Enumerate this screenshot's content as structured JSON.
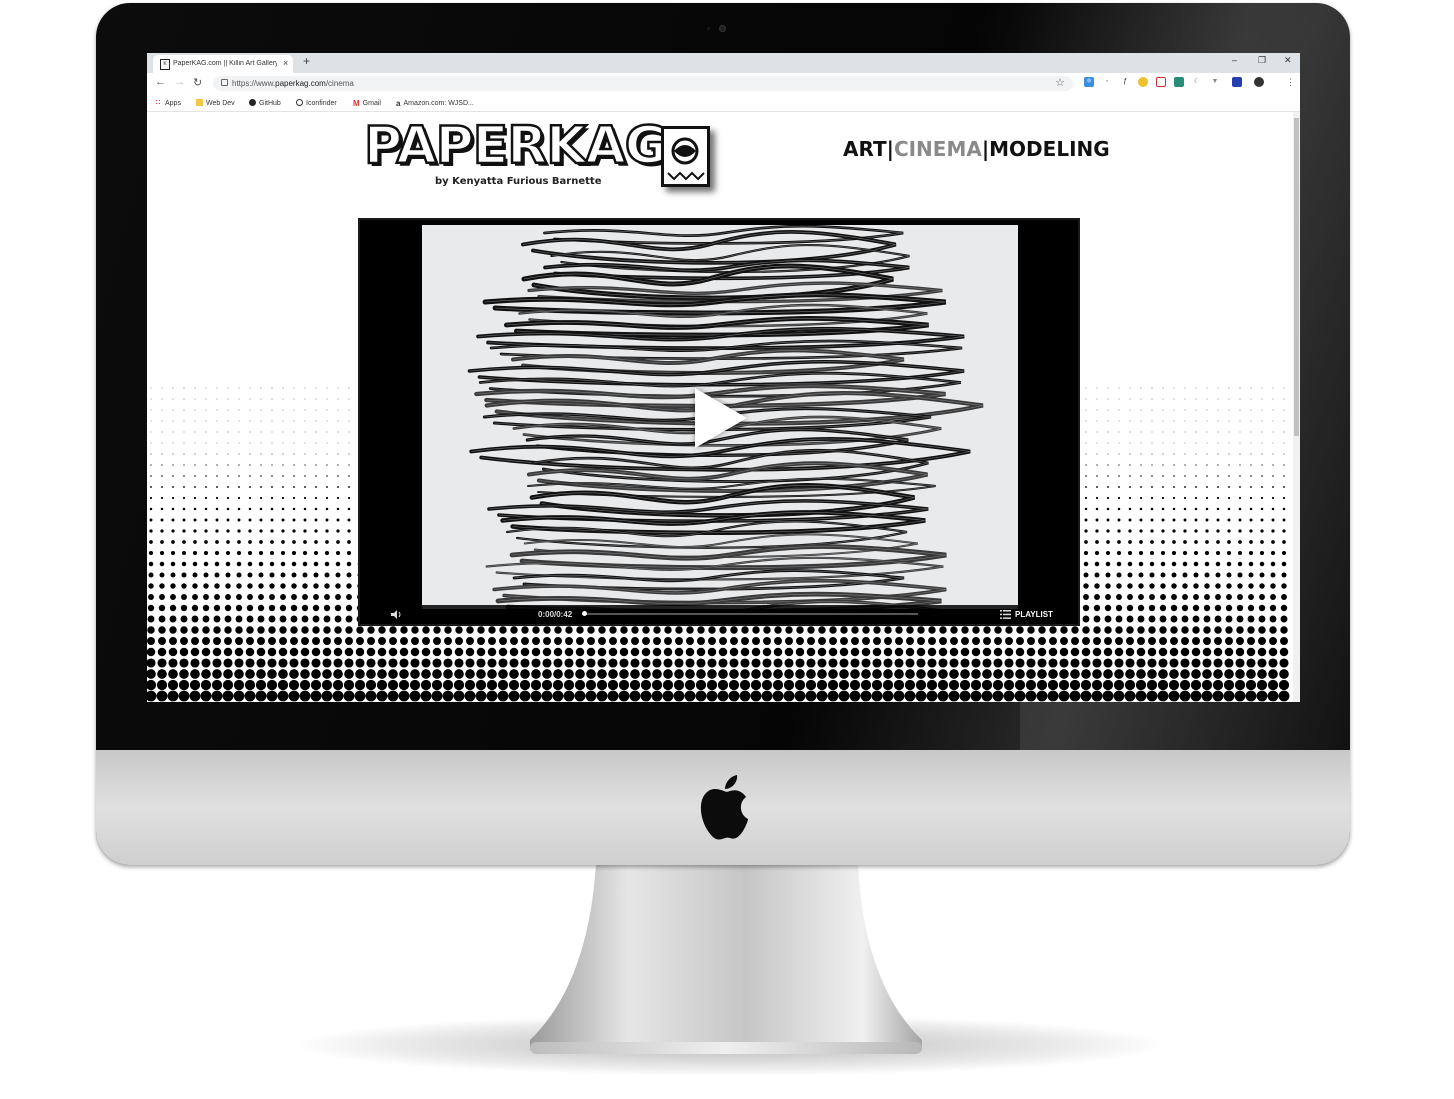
{
  "browser": {
    "tab_title": "PaperKAG.com || Killin Art Gallery",
    "tab_close": "×",
    "new_tab": "+",
    "url_scheme": "https://www.",
    "url_host": "paperkag.com",
    "url_path": "/cinema",
    "bookmarks": [
      {
        "label": "Apps"
      },
      {
        "label": "Web Dev"
      },
      {
        "label": "GitHub"
      },
      {
        "label": "Iconfinder"
      },
      {
        "label": "Gmail"
      },
      {
        "label": "Amazon.com: WJSD..."
      }
    ]
  },
  "site": {
    "brand": "PAPERKAG",
    "byline": "by Kenyatta Furious Barnette",
    "nav": {
      "art": "ART",
      "sep1": "|",
      "cinema": "CINEMA",
      "sep2": "|",
      "modeling": "MODELING",
      "active": "cinema",
      "active_color": "#8a8a8a"
    }
  },
  "player": {
    "time": "0:00/0:42",
    "playlist_label": "PLAYLIST",
    "progress": 0
  },
  "icons": [
    "apple-logo-icon",
    "play-icon",
    "volume-icon",
    "playlist-icon",
    "star-icon",
    "lock-icon",
    "back-icon",
    "forward-icon",
    "reload-icon"
  ],
  "colors": {
    "imac_bezel": "#050505",
    "imac_chin": "#d9d9d9",
    "tabbar": "#dee1e6",
    "player_bg": "#000000"
  }
}
